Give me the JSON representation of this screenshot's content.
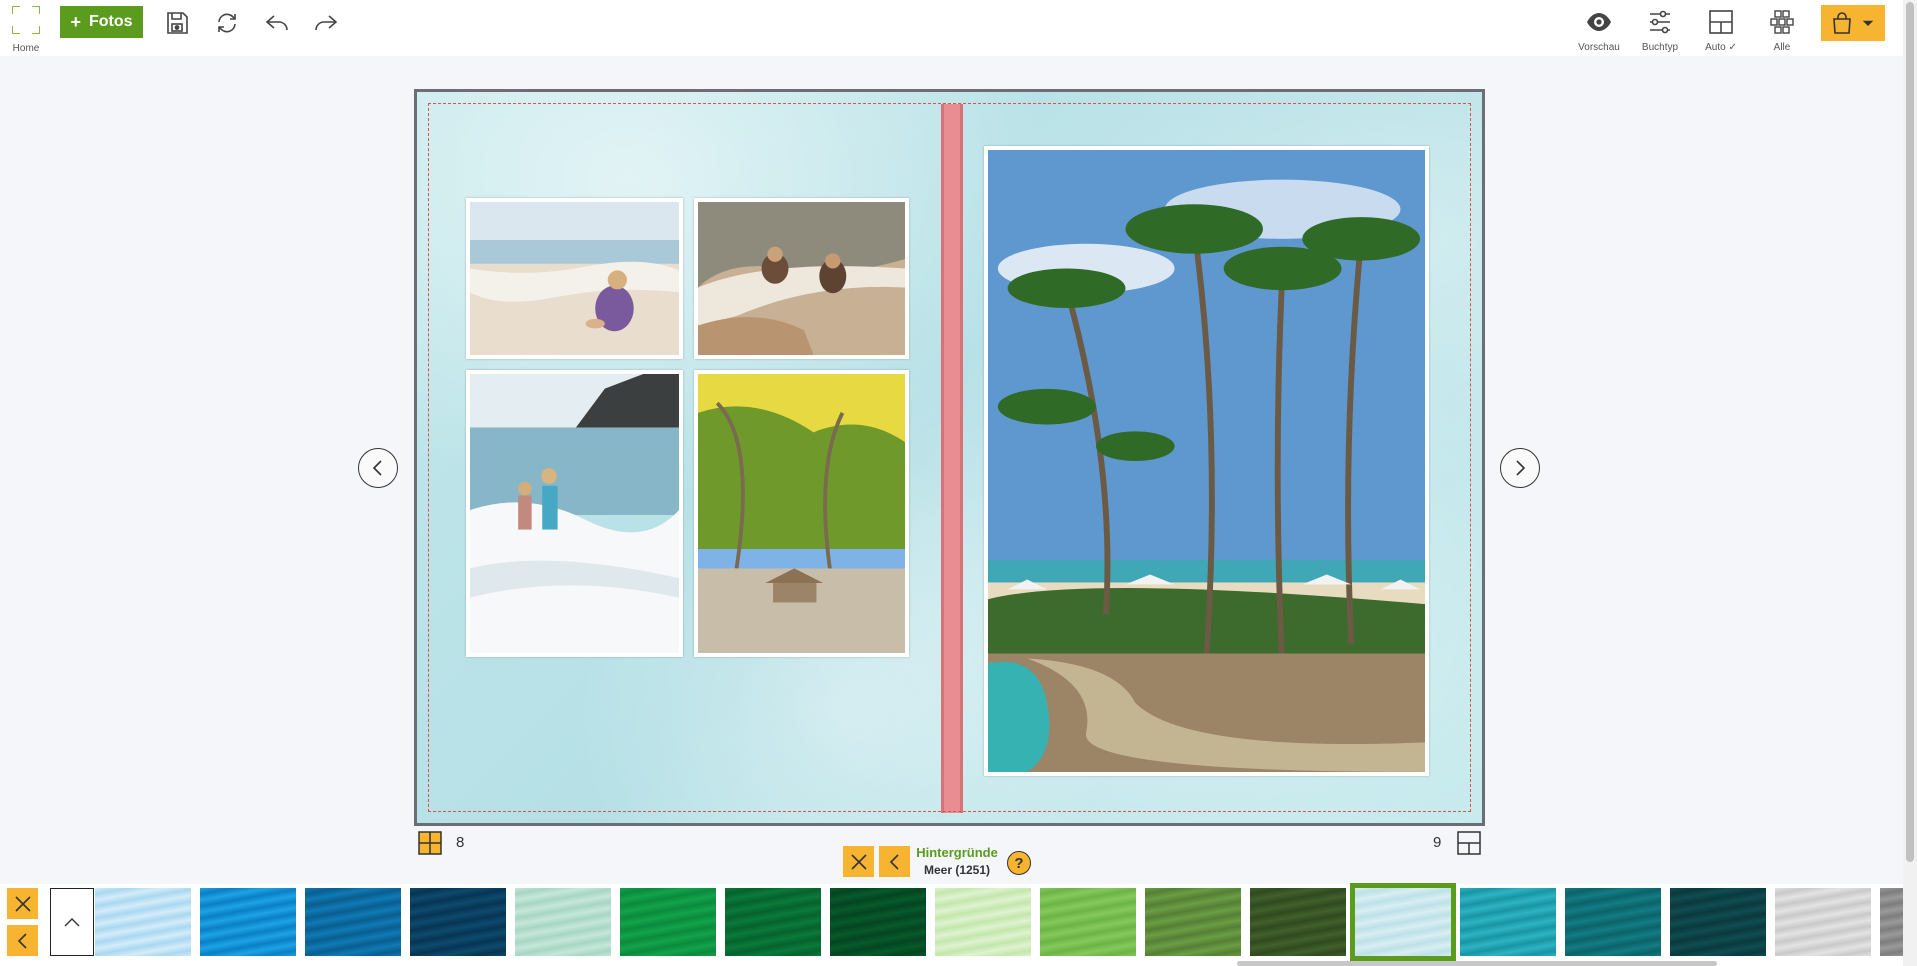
{
  "toolbar": {
    "home_label": "Home",
    "fotos_label": "Fotos",
    "right_tools": [
      {
        "name": "vorschau",
        "label": "Vorschau",
        "icon": "eye-icon"
      },
      {
        "name": "buchtyp",
        "label": "Buchtyp",
        "icon": "sliders-icon"
      },
      {
        "name": "auto",
        "label": "Auto ✓",
        "icon": "layout-icon"
      },
      {
        "name": "alle",
        "label": "Alle",
        "icon": "grid-layout-icon"
      }
    ],
    "icons": [
      "save-icon",
      "refresh-icon",
      "undo-icon",
      "redo-icon",
      "cart-icon",
      "chevron-down-icon"
    ]
  },
  "editor": {
    "left_page_number": "8",
    "right_page_number": "9"
  },
  "backgrounds": {
    "title": "Hintergründe",
    "subtitle": "Meer (1251)",
    "help_label": "?",
    "swatches": [
      {
        "id": "none"
      },
      {
        "color_a": "#d4ecf8",
        "color_b": "#a9d8f2"
      },
      {
        "color_a": "#1da3e6",
        "color_b": "#0a7fc4"
      },
      {
        "color_a": "#0f7ab5",
        "color_b": "#0a5d8f"
      },
      {
        "color_a": "#0d4a6e",
        "color_b": "#073553"
      },
      {
        "color_a": "#c5e7db",
        "color_b": "#a7d6c4"
      },
      {
        "color_a": "#12a34b",
        "color_b": "#0b8a3c"
      },
      {
        "color_a": "#0a7a3a",
        "color_b": "#06622d"
      },
      {
        "color_a": "#075a2b",
        "color_b": "#044521"
      },
      {
        "color_a": "#def2cf",
        "color_b": "#c4e7ad"
      },
      {
        "color_a": "#85c95c",
        "color_b": "#6cb446"
      },
      {
        "color_a": "#6a9d44",
        "color_b": "#557f35"
      },
      {
        "color_a": "#41602a",
        "color_b": "#304a1f"
      },
      {
        "color_a": "#d8eef2",
        "color_b": "#bde1e8",
        "selected": true
      },
      {
        "color_a": "#2eb3c2",
        "color_b": "#1895a5"
      },
      {
        "color_a": "#127c84",
        "color_b": "#0c6269"
      },
      {
        "color_a": "#0f4d52",
        "color_b": "#0a393d"
      },
      {
        "color_a": "#e3e3e3",
        "color_b": "#c9c9c9"
      },
      {
        "color_a": "#9a9a9a",
        "color_b": "#7d7d7d"
      }
    ]
  },
  "colors": {
    "accent_green": "#5b9b1e",
    "accent_orange": "#f7b430",
    "spine_red": "#e88e92"
  }
}
